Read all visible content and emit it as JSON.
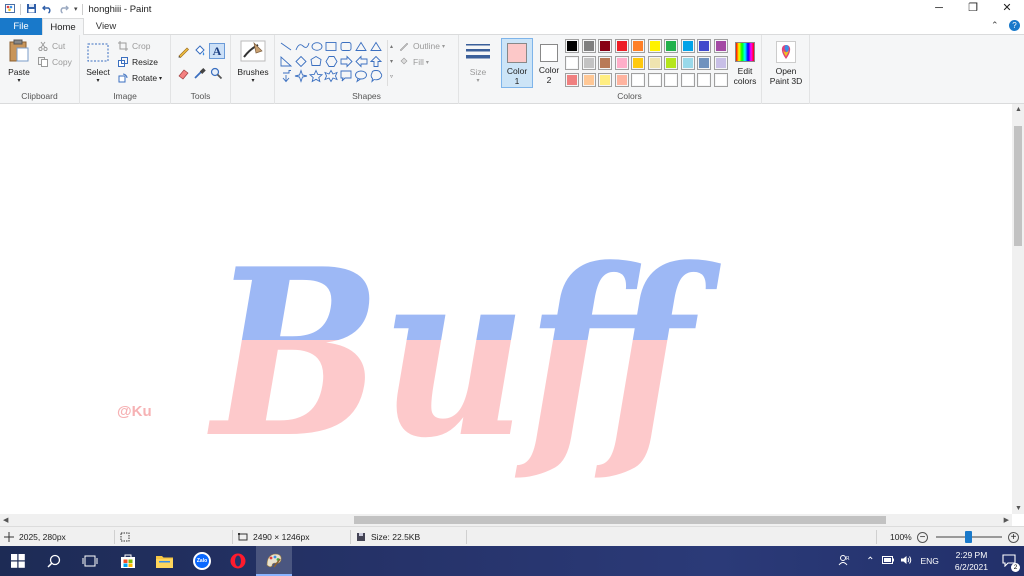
{
  "window": {
    "title": "honghiii - Paint",
    "controls": [
      "minimize",
      "restore",
      "close"
    ]
  },
  "menu": {
    "tabs": [
      "File",
      "Home",
      "View"
    ]
  },
  "ribbon": {
    "clipboard": {
      "group_label": "Clipboard",
      "paste": "Paste",
      "cut": "Cut",
      "copy": "Copy"
    },
    "image": {
      "group_label": "Image",
      "select": "Select",
      "crop": "Crop",
      "resize": "Resize",
      "rotate": "Rotate"
    },
    "tools": {
      "group_label": "Tools"
    },
    "brushes": {
      "label": "Brushes"
    },
    "shapes": {
      "group_label": "Shapes",
      "outline": "Outline",
      "fill": "Fill"
    },
    "size": {
      "label": "Size"
    },
    "colors": {
      "group_label": "Colors",
      "color1_label": "Color",
      "color1_num": "1",
      "color2_label": "Color",
      "color2_num": "2",
      "color1_value": "#fcc8c8",
      "color2_value": "#ffffff",
      "edit_colors_line1": "Edit",
      "edit_colors_line2": "colors",
      "palette_row1": [
        "#000000",
        "#7f7f7f",
        "#880015",
        "#ed1c24",
        "#ff7f27",
        "#fff200",
        "#22b14c",
        "#00a2e8",
        "#3f48cc",
        "#a349a4"
      ],
      "palette_row2": [
        "#ffffff",
        "#c3c3c3",
        "#b97a57",
        "#ffaec9",
        "#ffc90e",
        "#efe4b0",
        "#b5e61d",
        "#99d9ea",
        "#7092be",
        "#c8bfe7"
      ],
      "palette_row3": [
        "#f08080",
        "#ffc896",
        "#ffee82",
        "#ffb4a0",
        "#ffffff",
        "#ffffff",
        "#ffffff",
        "#ffffff",
        "#ffffff",
        "#ffffff"
      ]
    },
    "paint3d": {
      "line1": "Open",
      "line2": "Paint 3D"
    }
  },
  "canvas": {
    "artwork_text": "Buff",
    "watermark": "@Ku",
    "top_color": "#9db8f5",
    "bottom_color": "#fdc9cb",
    "watermark_color": "#f6b2b4"
  },
  "status": {
    "cursor_pos": "2025, 280px",
    "image_size": "2490 × 1246px",
    "file_size": "Size: 22.5KB",
    "zoom": "100%"
  },
  "taskbar": {
    "apps": [
      "start-icon",
      "search-icon",
      "task-view-icon",
      "store-icon",
      "file-explorer-icon",
      "zalo-icon",
      "opera-icon",
      "paint-icon"
    ],
    "zalo_label": "Zalo",
    "language": "ENG",
    "time": "2:29 PM",
    "date": "6/2/2021",
    "notifications": "2"
  }
}
